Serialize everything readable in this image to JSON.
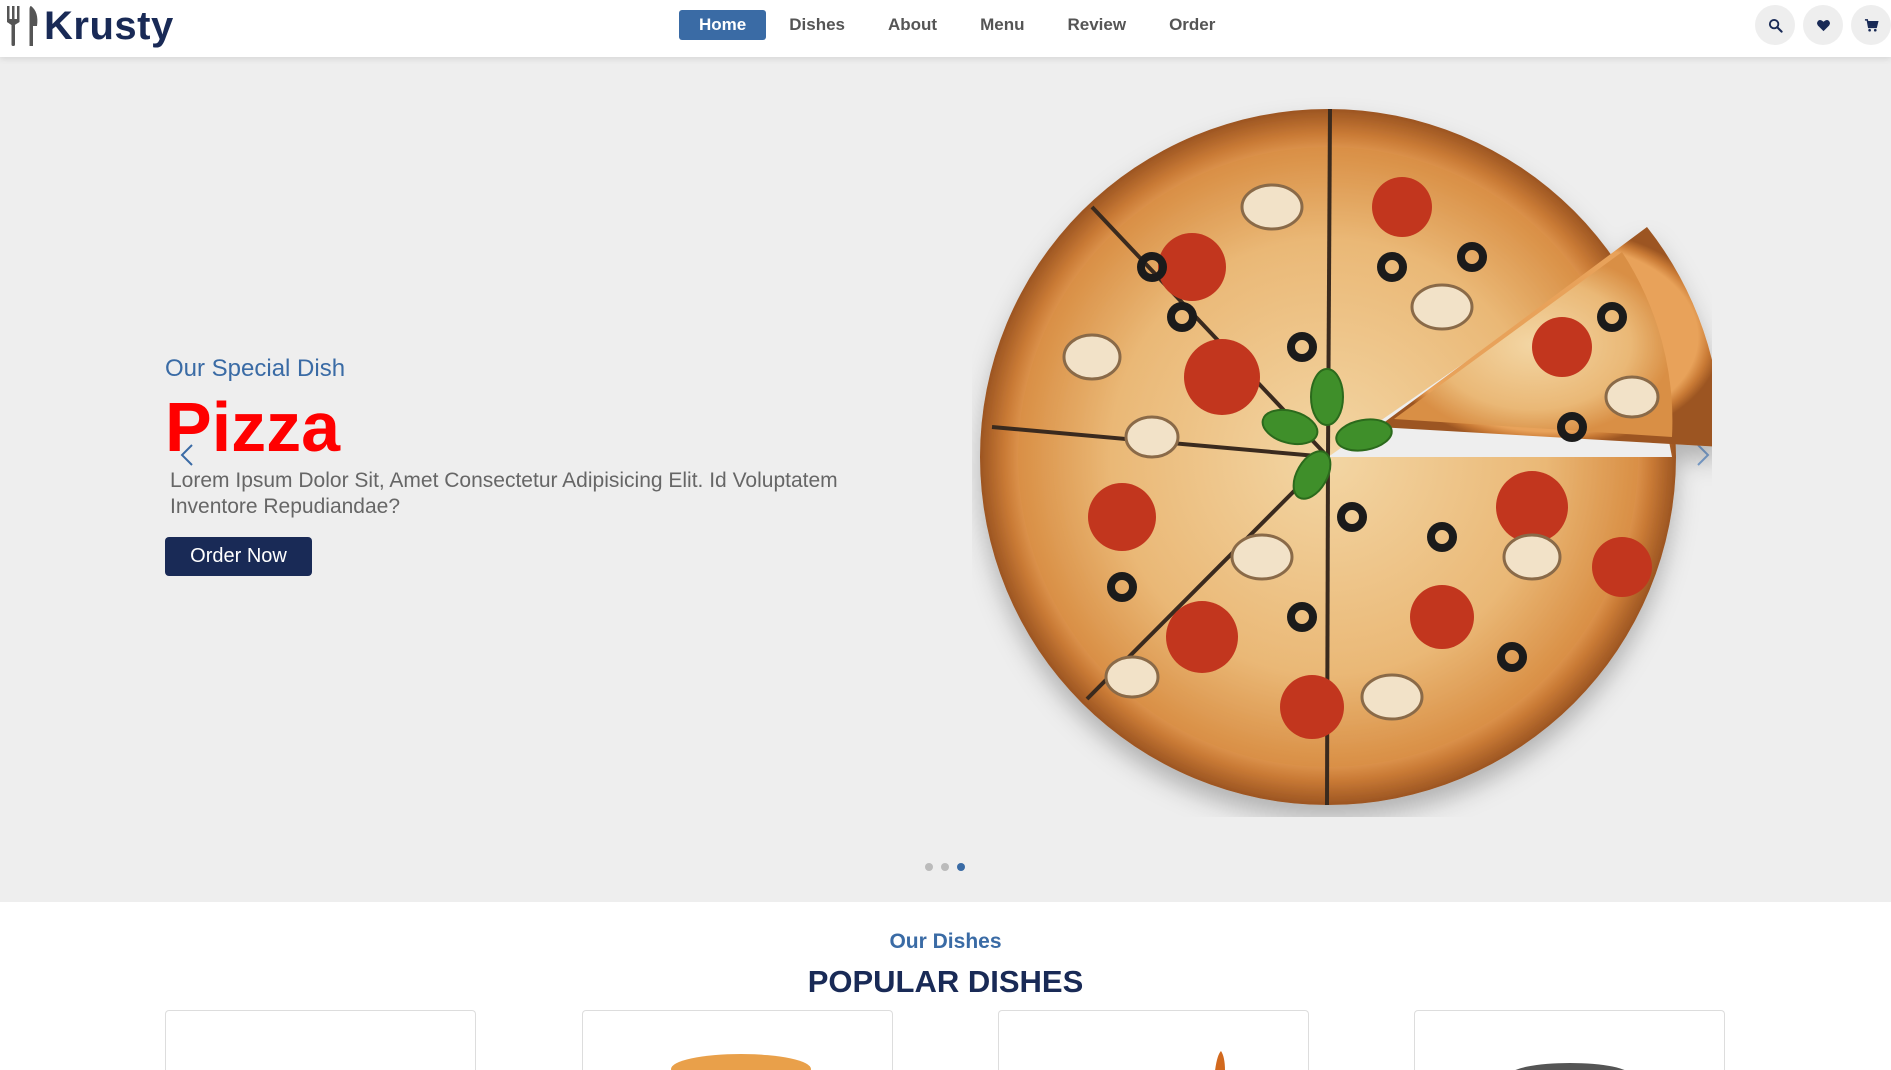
{
  "header": {
    "logo_text": "Krusty",
    "logo_icon": "utensils-icon",
    "nav": [
      {
        "label": "Home",
        "active": true
      },
      {
        "label": "Dishes",
        "active": false
      },
      {
        "label": "About",
        "active": false
      },
      {
        "label": "Menu",
        "active": false
      },
      {
        "label": "Review",
        "active": false
      },
      {
        "label": "Order",
        "active": false
      }
    ],
    "icons": [
      "search-icon",
      "heart-icon",
      "cart-icon"
    ]
  },
  "hero": {
    "subtitle": "Our Special Dish",
    "title": "Pizza",
    "description": "Lorem Ipsum Dolor Sit, Amet Consectetur Adipisicing Elit. Id Voluptatem Inventore Repudiandae?",
    "button_label": "Order Now",
    "slides": 3,
    "active_slide": 3
  },
  "dishes": {
    "subtitle": "Our Dishes",
    "title": "POPULAR DISHES"
  },
  "colors": {
    "brand_dark": "#192a56",
    "accent_blue": "#3a6ba5",
    "hero_title": "#ff0000",
    "hero_bg": "#eeeeee"
  }
}
